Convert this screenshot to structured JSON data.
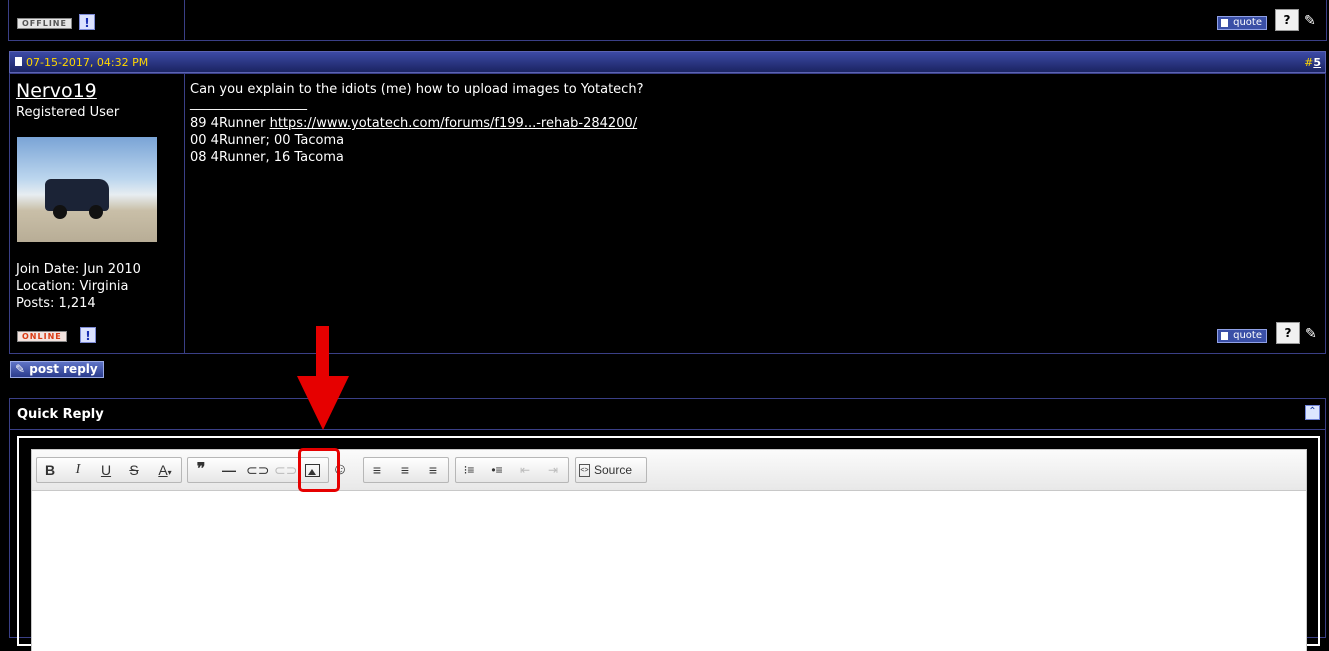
{
  "previous_post": {
    "status_badge": "OFFLINE",
    "report_icon": "report-icon",
    "quote_label": "quote",
    "multiquote_icon": "multiquote-icon",
    "edit_icon": "edit-icon"
  },
  "post": {
    "date": "07-15-2017, 04:32 PM",
    "number_prefix": "#",
    "number": "5",
    "user": {
      "name": "Nervo19",
      "title": "Registered User",
      "join_date": "Join Date: Jun 2010",
      "location": "Location: Virginia",
      "posts": "Posts: 1,214",
      "status_badge": "ONLINE"
    },
    "message": "Can you explain to the idiots (me) how to upload images to Yotatech?",
    "signature_separator": "__________________",
    "signature": {
      "line1_prefix": "89 4Runner ",
      "line1_link": "https://www.yotatech.com/forums/f199...-rehab-284200/",
      "line2": "00 4Runner; 00 Tacoma",
      "line3": "08 4Runner, 16 Tacoma"
    },
    "quote_label": "quote"
  },
  "post_reply": {
    "label": "post reply"
  },
  "quick_reply": {
    "title": "Quick Reply",
    "toolbar": {
      "bold": "B",
      "italic": "I",
      "underline": "U",
      "strike": "S",
      "text_color": "A",
      "quote": "❞",
      "hr": "—",
      "source_label": "Source"
    }
  },
  "annotation_color": "#e60000"
}
